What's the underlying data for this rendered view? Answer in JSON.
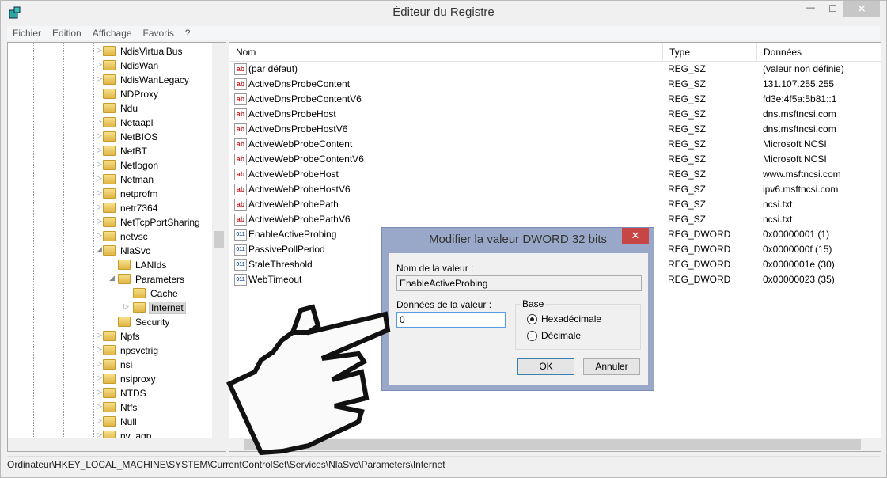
{
  "window": {
    "title": "Éditeur du Registre",
    "minimize": "—",
    "maximize": "☐",
    "close": "✕"
  },
  "menu": [
    "Fichier",
    "Edition",
    "Affichage",
    "Favoris",
    "?"
  ],
  "tree": [
    {
      "label": "NdisVirtualBus",
      "level": 1,
      "arrow": "collapsed"
    },
    {
      "label": "NdisWan",
      "level": 1,
      "arrow": "collapsed"
    },
    {
      "label": "NdisWanLegacy",
      "level": 1,
      "arrow": "collapsed"
    },
    {
      "label": "NDProxy",
      "level": 1,
      "arrow": "none"
    },
    {
      "label": "Ndu",
      "level": 1,
      "arrow": "none"
    },
    {
      "label": "Netaapl",
      "level": 1,
      "arrow": "collapsed"
    },
    {
      "label": "NetBIOS",
      "level": 1,
      "arrow": "collapsed"
    },
    {
      "label": "NetBT",
      "level": 1,
      "arrow": "collapsed"
    },
    {
      "label": "Netlogon",
      "level": 1,
      "arrow": "collapsed"
    },
    {
      "label": "Netman",
      "level": 1,
      "arrow": "collapsed"
    },
    {
      "label": "netprofm",
      "level": 1,
      "arrow": "collapsed"
    },
    {
      "label": "netr7364",
      "level": 1,
      "arrow": "collapsed"
    },
    {
      "label": "NetTcpPortSharing",
      "level": 1,
      "arrow": "collapsed"
    },
    {
      "label": "netvsc",
      "level": 1,
      "arrow": "collapsed"
    },
    {
      "label": "NlaSvc",
      "level": 1,
      "arrow": "expanded"
    },
    {
      "label": "LANIds",
      "level": 2,
      "arrow": "none"
    },
    {
      "label": "Parameters",
      "level": 2,
      "arrow": "expanded"
    },
    {
      "label": "Cache",
      "level": 3,
      "arrow": "none"
    },
    {
      "label": "Internet",
      "level": 3,
      "arrow": "collapsed",
      "selected": true
    },
    {
      "label": "Security",
      "level": 2,
      "arrow": "none"
    },
    {
      "label": "Npfs",
      "level": 1,
      "arrow": "collapsed"
    },
    {
      "label": "npsvctrig",
      "level": 1,
      "arrow": "collapsed"
    },
    {
      "label": "nsi",
      "level": 1,
      "arrow": "collapsed"
    },
    {
      "label": "nsiproxy",
      "level": 1,
      "arrow": "collapsed"
    },
    {
      "label": "NTDS",
      "level": 1,
      "arrow": "collapsed"
    },
    {
      "label": "Ntfs",
      "level": 1,
      "arrow": "collapsed"
    },
    {
      "label": "Null",
      "level": 1,
      "arrow": "collapsed"
    },
    {
      "label": "nv_agp",
      "level": 1,
      "arrow": "collapsed"
    }
  ],
  "list": {
    "columns": [
      "Nom",
      "Type",
      "Données"
    ],
    "rows": [
      {
        "name": "(par défaut)",
        "type": "REG_SZ",
        "data": "(valeur non définie)",
        "icon": "string-value-icon"
      },
      {
        "name": "ActiveDnsProbeContent",
        "type": "REG_SZ",
        "data": "131.107.255.255",
        "icon": "string-value-icon"
      },
      {
        "name": "ActiveDnsProbeContentV6",
        "type": "REG_SZ",
        "data": "fd3e:4f5a:5b81::1",
        "icon": "string-value-icon"
      },
      {
        "name": "ActiveDnsProbeHost",
        "type": "REG_SZ",
        "data": "dns.msftncsi.com",
        "icon": "string-value-icon"
      },
      {
        "name": "ActiveDnsProbeHostV6",
        "type": "REG_SZ",
        "data": "dns.msftncsi.com",
        "icon": "string-value-icon"
      },
      {
        "name": "ActiveWebProbeContent",
        "type": "REG_SZ",
        "data": "Microsoft NCSI",
        "icon": "string-value-icon"
      },
      {
        "name": "ActiveWebProbeContentV6",
        "type": "REG_SZ",
        "data": "Microsoft NCSI",
        "icon": "string-value-icon"
      },
      {
        "name": "ActiveWebProbeHost",
        "type": "REG_SZ",
        "data": "www.msftncsi.com",
        "icon": "string-value-icon"
      },
      {
        "name": "ActiveWebProbeHostV6",
        "type": "REG_SZ",
        "data": "ipv6.msftncsi.com",
        "icon": "string-value-icon"
      },
      {
        "name": "ActiveWebProbePath",
        "type": "REG_SZ",
        "data": "ncsi.txt",
        "icon": "string-value-icon"
      },
      {
        "name": "ActiveWebProbePathV6",
        "type": "REG_SZ",
        "data": "ncsi.txt",
        "icon": "string-value-icon"
      },
      {
        "name": "EnableActiveProbing",
        "type": "REG_DWORD",
        "data": "0x00000001 (1)",
        "icon": "dword-value-icon"
      },
      {
        "name": "PassivePollPeriod",
        "type": "REG_DWORD",
        "data": "0x0000000f (15)",
        "icon": "dword-value-icon"
      },
      {
        "name": "StaleThreshold",
        "type": "REG_DWORD",
        "data": "0x0000001e (30)",
        "icon": "dword-value-icon"
      },
      {
        "name": "WebTimeout",
        "type": "REG_DWORD",
        "data": "0x00000023 (35)",
        "icon": "dword-value-icon"
      }
    ]
  },
  "status": "Ordinateur\\HKEY_LOCAL_MACHINE\\SYSTEM\\CurrentControlSet\\Services\\NlaSvc\\Parameters\\Internet",
  "dialog": {
    "title": "Modifier la valeur DWORD 32 bits",
    "close": "✕",
    "name_label": "Nom de la valeur :",
    "name_value": "EnableActiveProbing",
    "data_label": "Données de la valeur :",
    "data_value": "0",
    "base_label": "Base",
    "base_options": [
      {
        "label": "Hexadécimale",
        "checked": true
      },
      {
        "label": "Décimale",
        "checked": false
      }
    ],
    "ok": "OK",
    "cancel": "Annuler"
  }
}
